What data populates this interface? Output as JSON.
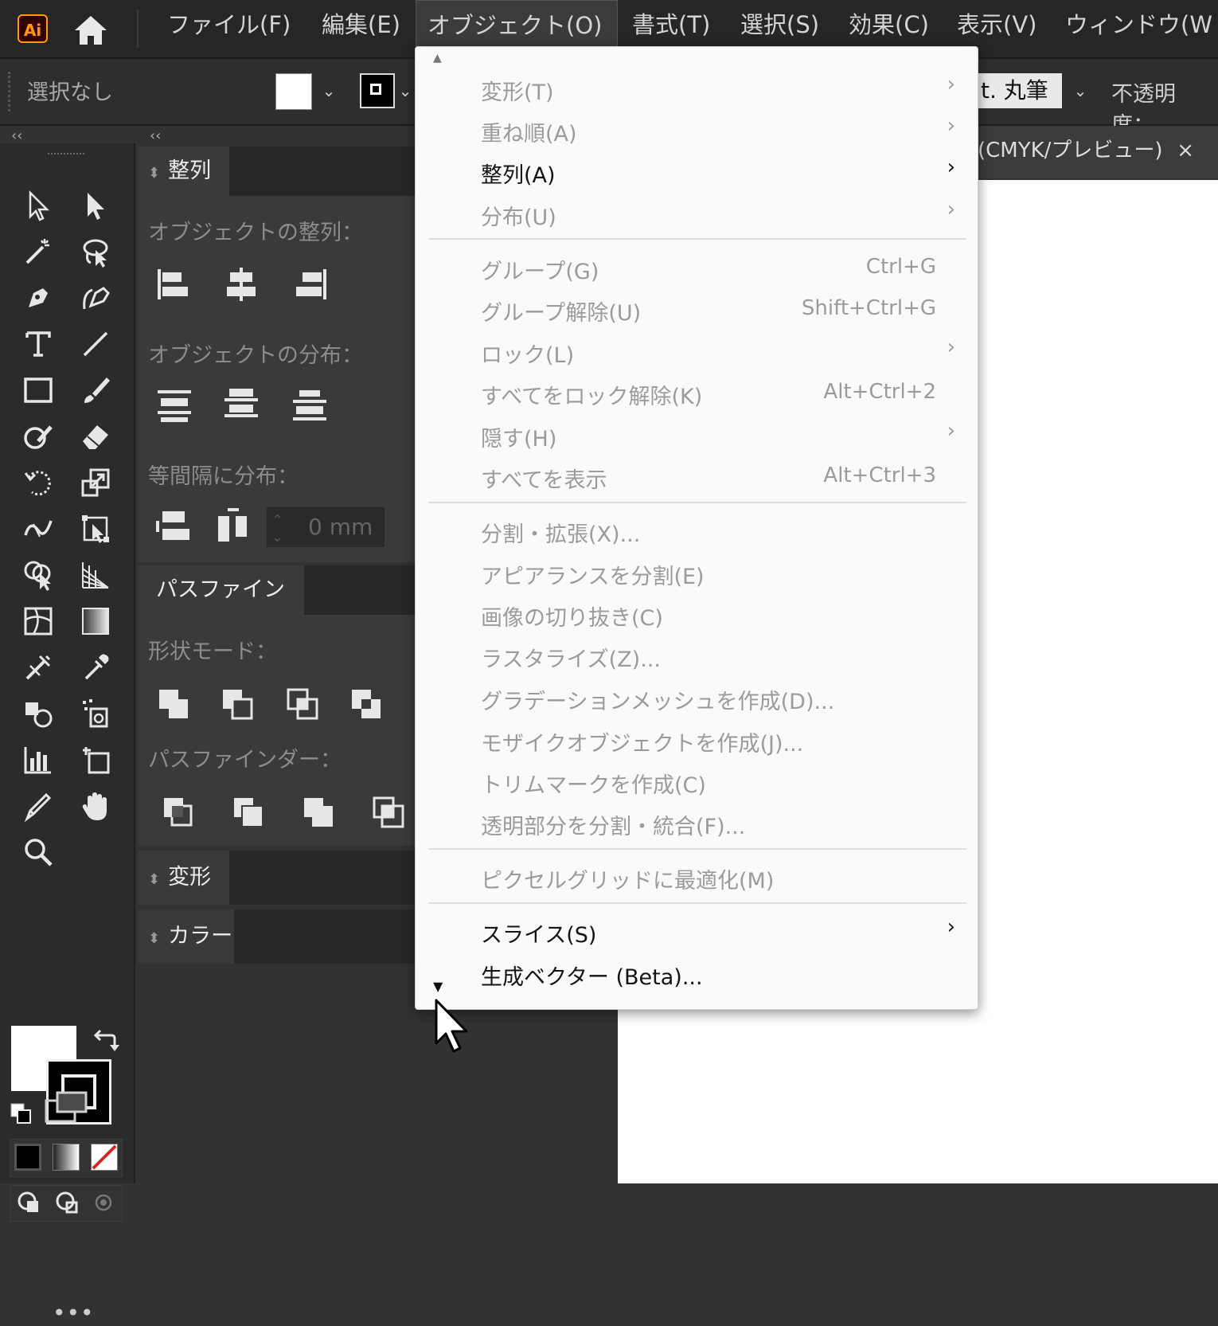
{
  "app": {
    "logo": "Ai"
  },
  "menubar": {
    "items": [
      "ファイル(F)",
      "編集(E)",
      "オブジェクト(O)",
      "書式(T)",
      "選択(S)",
      "効果(C)",
      "表示(V)",
      "ウィンドウ(W"
    ]
  },
  "control_bar": {
    "selection": "選択なし",
    "brush": "t. 丸筆",
    "opacity": "不透明度："
  },
  "document": {
    "tab_title": "(CMYK/プレビュー)",
    "close": "×"
  },
  "collapse": "‹‹",
  "panels": {
    "align": {
      "tab": "整列",
      "align_objects": "オブジェクトの整列：",
      "distribute_objects": "オブジェクトの分布：",
      "distribute_spacing": "等間隔に分布：",
      "spacing_value": "0 mm"
    },
    "pathfinder": {
      "tab": "パスファインダー",
      "shape_modes": "形状モード：",
      "pathfinders": "パスファインダー："
    },
    "transform": {
      "tab": "変形"
    },
    "color": {
      "tab": "カラー"
    }
  },
  "object_menu": {
    "items": [
      {
        "label": "変形(T)",
        "submenu": true,
        "enabled": false
      },
      {
        "label": "重ね順(A)",
        "submenu": true,
        "enabled": false
      },
      {
        "label": "整列(A)",
        "submenu": true,
        "enabled": true
      },
      {
        "label": "分布(U)",
        "submenu": true,
        "enabled": false
      },
      {
        "label": "グループ(G)",
        "shortcut": "Ctrl+G",
        "enabled": false
      },
      {
        "label": "グループ解除(U)",
        "shortcut": "Shift+Ctrl+G",
        "enabled": false
      },
      {
        "label": "ロック(L)",
        "submenu": true,
        "enabled": false
      },
      {
        "label": "すべてをロック解除(K)",
        "shortcut": "Alt+Ctrl+2",
        "enabled": false
      },
      {
        "label": "隠す(H)",
        "submenu": true,
        "enabled": false
      },
      {
        "label": "すべてを表示",
        "shortcut": "Alt+Ctrl+3",
        "enabled": false
      },
      {
        "label": "分割・拡張(X)...",
        "enabled": false
      },
      {
        "label": "アピアランスを分割(E)",
        "enabled": false
      },
      {
        "label": "画像の切り抜き(C)",
        "enabled": false
      },
      {
        "label": "ラスタライズ(Z)...",
        "enabled": false
      },
      {
        "label": "グラデーションメッシュを作成(D)...",
        "enabled": false
      },
      {
        "label": "モザイクオブジェクトを作成(J)...",
        "enabled": false
      },
      {
        "label": "トリムマークを作成(C)",
        "enabled": false
      },
      {
        "label": "透明部分を分割・統合(F)...",
        "enabled": false
      },
      {
        "label": "ピクセルグリッドに最適化(M)",
        "enabled": false
      },
      {
        "label": "スライス(S)",
        "submenu": true,
        "enabled": true
      },
      {
        "label": "生成ベクター (Beta)...",
        "enabled": true
      }
    ],
    "submenu_arrow": "›"
  },
  "colors": {
    "menu_bg": "#fafafa",
    "ui_dark": "#323232",
    "ai_orange": "#ff9a00"
  }
}
